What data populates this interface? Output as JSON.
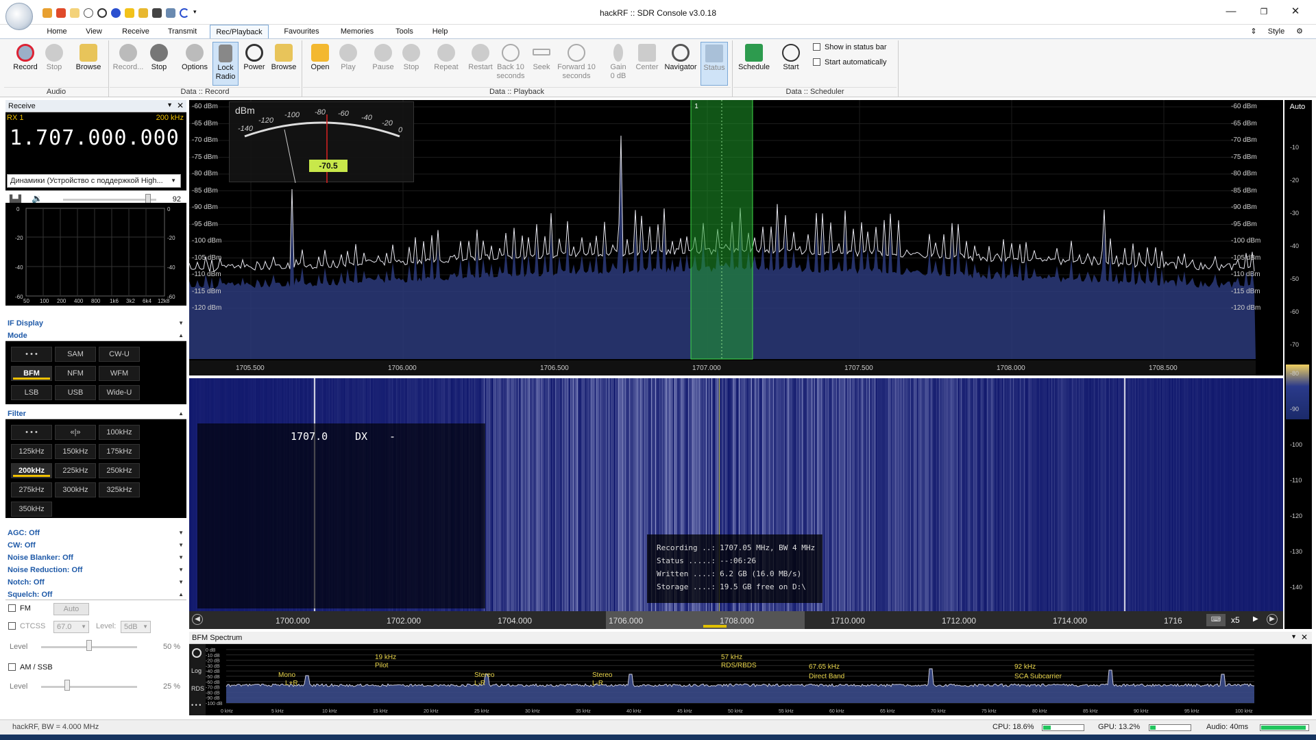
{
  "window": {
    "title": "hackRF :: SDR Console v3.0.18",
    "style_label": "Style"
  },
  "menu": [
    "Home",
    "View",
    "Receive",
    "Transmit",
    "Rec/Playback",
    "Favourites",
    "Memories",
    "Tools",
    "Help"
  ],
  "ribbon": {
    "audio": {
      "group": "Audio",
      "record": "Record",
      "stop": "Stop",
      "browse": "Browse"
    },
    "data_record": {
      "group": "Data :: Record",
      "record": "Record...",
      "stop": "Stop",
      "options": "Options",
      "lock_radio": "Lock Radio",
      "power": "Power",
      "browse": "Browse"
    },
    "data_playback": {
      "group": "Data :: Playback",
      "open": "Open",
      "play": "Play",
      "pause": "Pause",
      "stop": "Stop",
      "repeat": "Repeat",
      "restart": "Restart",
      "back": "Back 10 seconds",
      "seek": "Seek",
      "forward": "Forward 10 seconds",
      "gain": "Gain",
      "gain_value": "0 dB",
      "center": "Center",
      "navigator": "Navigator",
      "status": "Status"
    },
    "data_scheduler": {
      "group": "Data :: Scheduler",
      "schedule": "Schedule",
      "start": "Start",
      "show_in_status_bar": "Show in status bar",
      "start_automatically": "Start automatically"
    }
  },
  "receive": {
    "title": "Receive",
    "rx": "RX 1",
    "bw": "200 kHz",
    "frequency": "1.707.000.000",
    "audio_device": "Динамики (Устройство с поддержкой High...",
    "volume": "92",
    "scope_left": [
      "0",
      "-20",
      "-40",
      "-60"
    ],
    "scope_right": [
      "0",
      "-20",
      "-40",
      "-60"
    ],
    "scope_freqs": [
      "50",
      "100",
      "200",
      "400",
      "800",
      "1k6",
      "3k2",
      "6k4",
      "12k8"
    ],
    "if_display": "IF Display",
    "mode_title": "Mode",
    "modes": [
      [
        "• • •",
        "SAM",
        "CW-U"
      ],
      [
        "BFM",
        "NFM",
        "WFM"
      ],
      [
        "LSB",
        "USB",
        "Wide-U"
      ]
    ],
    "mode_selected": "BFM",
    "filter_title": "Filter",
    "filters": [
      [
        "• • •",
        "«|»",
        "100kHz"
      ],
      [
        "125kHz",
        "150kHz",
        "175kHz"
      ],
      [
        "200kHz",
        "225kHz",
        "250kHz"
      ],
      [
        "275kHz",
        "300kHz",
        "325kHz"
      ],
      [
        "350kHz"
      ]
    ],
    "filter_selected": "200kHz",
    "agc": "AGC: Off",
    "cw": "CW: Off",
    "noise_blanker": "Noise Blanker: Off",
    "noise_reduction": "Noise Reduction: Off",
    "notch": "Notch: Off",
    "squelch": "Squelch: Off",
    "fm_label": "FM",
    "fm_auto": "Auto",
    "ctcss": "CTCSS",
    "ctcss_val": "67.0",
    "level_label": "Level:",
    "level_val": "5dB",
    "level": "Level",
    "level_fm_pct": "50 %",
    "am_ssb": "AM / SSB",
    "level_am_pct": "25 %"
  },
  "spectrum": {
    "db_labels": [
      "-60 dBm",
      "-65 dBm",
      "-70 dBm",
      "-75 dBm",
      "-80 dBm",
      "-85 dBm",
      "-90 dBm",
      "-95 dBm",
      "-100 dBm",
      "-105 dBm",
      "-110 dBm",
      "-115 dBm",
      "-120 dBm"
    ],
    "freq_labels": [
      "1705.500",
      "1706.000",
      "1706.500",
      "1707.000",
      "1707.500",
      "1708.000",
      "1708.500"
    ],
    "meter_unit": "dBm",
    "meter_scale": [
      "-140",
      "-120",
      "-100",
      "-80",
      "-60",
      "-40",
      "-20",
      "0"
    ],
    "meter_value": "-70.5",
    "marker": "1",
    "auto": "Auto",
    "right_scale": [
      "-10",
      "-20",
      "-30",
      "-40",
      "-50",
      "-60",
      "-70"
    ]
  },
  "waterfall": {
    "overlay": {
      "freq": "1707.0",
      "mode": "DX",
      "dash": "-"
    },
    "status": [
      [
        "Recording ..:",
        "1707.05 MHz, BW 4 MHz"
      ],
      [
        "Status .....:",
        "--:06:26"
      ],
      [
        "Written ....:",
        "6.2 GB (16.0 MB/s)"
      ],
      [
        "Storage ....:",
        "19.5 GB free on D:\\"
      ]
    ],
    "axis": [
      "1700.000",
      "1702.000",
      "1704.000",
      "1706.000",
      "1708.000",
      "1710.000",
      "1712.000",
      "1714.000",
      "1716"
    ],
    "zoom": "x5",
    "right_scale": [
      "-80",
      "-90",
      "-100",
      "-110",
      "-120",
      "-130",
      "-140"
    ]
  },
  "bfm": {
    "title": "BFM Spectrum",
    "side": [
      "Log",
      "RDS",
      "• • •"
    ],
    "db": [
      "0 dB",
      "-10 dB",
      "-20 dB",
      "-30 dB",
      "-40 dB",
      "-50 dB",
      "-60 dB",
      "-70 dB",
      "-80 dB",
      "-90 dB",
      "-100 dB"
    ],
    "bands": [
      [
        "Mono",
        "L+R"
      ],
      [
        "19 kHz",
        "Pilot"
      ],
      [
        "Stereo",
        "L-R"
      ],
      [
        "Stereo",
        "L-R"
      ],
      [
        "57 kHz",
        "RDS/RBDS"
      ],
      [
        "67.65 kHz",
        "Direct Band"
      ],
      [
        "92 kHz",
        "SCA Subcarrier"
      ]
    ],
    "freqs": [
      "0 kHz",
      "5 kHz",
      "10 kHz",
      "15 kHz",
      "20 kHz",
      "25 kHz",
      "30 kHz",
      "35 kHz",
      "40 kHz",
      "45 kHz",
      "50 kHz",
      "55 kHz",
      "60 kHz",
      "65 kHz",
      "70 kHz",
      "75 kHz",
      "80 kHz",
      "85 kHz",
      "90 kHz",
      "95 kHz",
      "100 kHz"
    ]
  },
  "status": {
    "left": "hackRF, BW = 4.000 MHz",
    "cpu": "CPU: 18.6%",
    "gpu": "GPU: 13.2%",
    "audio": "Audio: 40ms",
    "cpu_frac": 0.19,
    "gpu_frac": 0.13,
    "audio_frac": 0.95
  },
  "colors": {
    "accent": "#1f5aa8",
    "marker": "#22c55e",
    "meter": "#c8e84a"
  }
}
